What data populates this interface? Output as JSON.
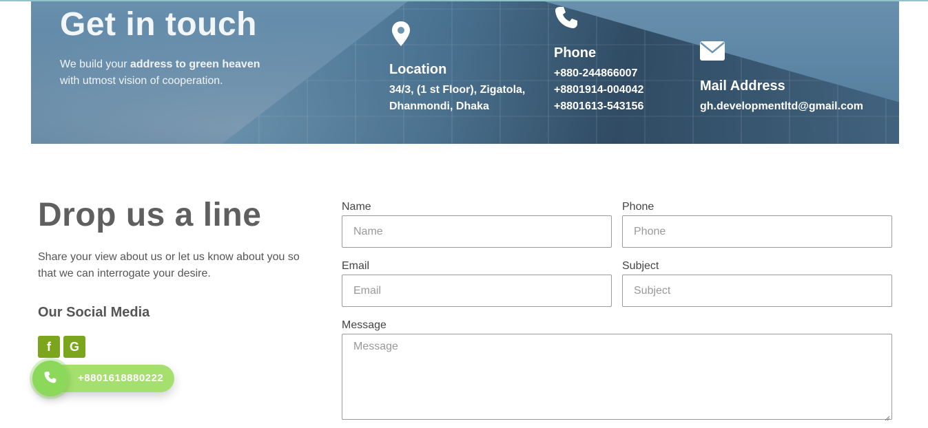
{
  "hero": {
    "title": "Get in touch",
    "subtitle_prefix": "We build your ",
    "subtitle_bold": "address to green heaven",
    "subtitle_suffix": "with utmost vision of cooperation.",
    "location": {
      "icon": "map-pin-icon",
      "title": "Location",
      "lines": [
        "34/3, (1 st Floor), Zigatola,",
        "Dhanmondi, Dhaka"
      ]
    },
    "phone": {
      "icon": "phone-icon",
      "title": "Phone",
      "lines": [
        "+880-244866007",
        "+8801914-004042",
        "+8801613-543156"
      ]
    },
    "mail": {
      "icon": "envelope-icon",
      "title": "Mail Address",
      "lines": [
        "gh.developmentltd@gmail.com"
      ]
    }
  },
  "contact": {
    "title": "Drop us a line",
    "description": "Share your view about us or let us know about you so that we can interrogate your desire.",
    "social_title": "Our Social Media",
    "social": [
      {
        "icon": "facebook-icon",
        "glyph": "f"
      },
      {
        "icon": "google-icon",
        "glyph": "G"
      }
    ]
  },
  "form": {
    "name": {
      "label": "Name",
      "placeholder": "Name"
    },
    "phone": {
      "label": "Phone",
      "placeholder": "Phone"
    },
    "email": {
      "label": "Email",
      "placeholder": "Email"
    },
    "subject": {
      "label": "Subject",
      "placeholder": "Subject"
    },
    "message": {
      "label": "Message",
      "placeholder": "Message"
    }
  },
  "call_widget": {
    "number": "+8801618880222"
  },
  "colors": {
    "accent": "#7ba51c",
    "call_green": "#a5df6e"
  }
}
